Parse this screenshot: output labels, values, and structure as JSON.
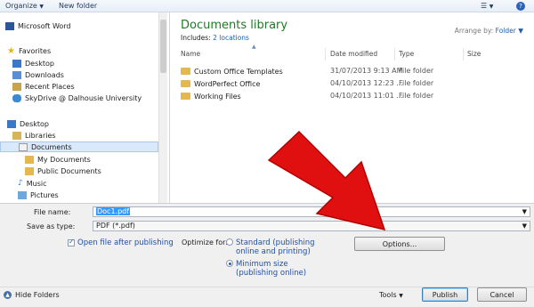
{
  "toolbar": {
    "organize": "Organize",
    "new_folder": "New folder",
    "view_icon": "view-options-icon",
    "help_icon": "help-icon"
  },
  "nav": {
    "top_item": "Microsoft Word",
    "favorites": "Favorites",
    "fav_items": [
      "Desktop",
      "Downloads",
      "Recent Places",
      "SkyDrive @ Dalhousie University"
    ],
    "desktop": "Desktop",
    "libraries": "Libraries",
    "documents": "Documents",
    "doc_items": [
      "My Documents",
      "Public Documents"
    ],
    "music": "Music",
    "pictures": "Pictures"
  },
  "library": {
    "title": "Documents library",
    "includes_label": "Includes:",
    "includes_link": "2 locations",
    "arrange_label": "Arrange by:",
    "arrange_value": "Folder"
  },
  "columns": [
    "Name",
    "Date modified",
    "Type",
    "Size"
  ],
  "files": [
    {
      "name": "Custom Office Templates",
      "date": "31/07/2013 9:13 AM",
      "type": "File folder"
    },
    {
      "name": "WordPerfect Office",
      "date": "04/10/2013 12:23 ...",
      "type": "File folder"
    },
    {
      "name": "Working Files",
      "date": "04/10/2013 11:01 ...",
      "type": "File folder"
    }
  ],
  "form": {
    "file_name_label": "File name:",
    "file_name_value": "Doc1.pdf",
    "save_type_label": "Save as type:",
    "save_type_value": "PDF (*.pdf)",
    "open_after_label": "Open file after publishing",
    "optimize_label": "Optimize for:",
    "standard_label": "Standard (publishing\nonline and printing)",
    "minimum_label": "Minimum size\n(publishing online)",
    "options_button": "Options...",
    "hide_folders": "Hide Folders",
    "tools": "Tools",
    "publish": "Publish",
    "cancel": "Cancel"
  },
  "colors": {
    "arrow": "#e01010",
    "library_title": "#1e7a26",
    "link": "#1c5fb5"
  }
}
